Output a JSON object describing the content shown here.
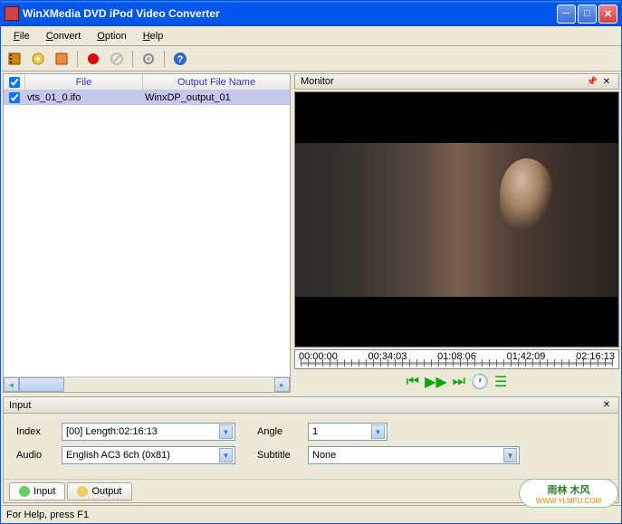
{
  "titlebar": {
    "text": "WinXMedia DVD iPod Video Converter"
  },
  "menu": {
    "file": "File",
    "convert": "Convert",
    "option": "Option",
    "help": "Help"
  },
  "filelist": {
    "col1": "File",
    "col2": "Output File Name",
    "rows": [
      {
        "file": "vts_01_0.ifo",
        "output": "WinxDP_output_01"
      }
    ]
  },
  "monitor": {
    "title": "Monitor"
  },
  "timeline": {
    "t0": "00:00:00",
    "t1": "00:34:03",
    "t2": "01:08:06",
    "t3": "01:42:09",
    "t4": "02:16:13"
  },
  "input": {
    "title": "Input",
    "index_label": "Index",
    "index_value": "[00] Length:02:16:13",
    "angle_label": "Angle",
    "angle_value": "1",
    "audio_label": "Audio",
    "audio_value": "English AC3 6ch (0x81)",
    "subtitle_label": "Subtitle",
    "subtitle_value": "None"
  },
  "tabs": {
    "input": "Input",
    "output": "Output"
  },
  "status": {
    "text": "For Help, press F1"
  },
  "watermark": {
    "line1": "雨林 木风",
    "line2": "WWW.YLMFU.COM"
  }
}
